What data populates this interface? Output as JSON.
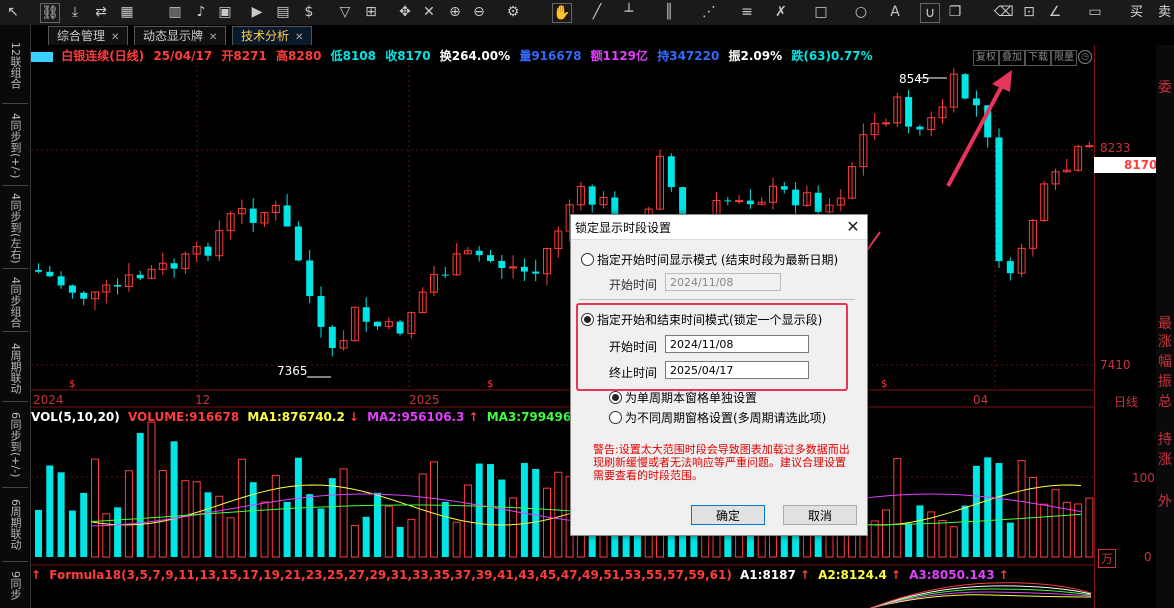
{
  "toolbar": {
    "buy_label": "买",
    "sell_label": "卖"
  },
  "tabs": [
    {
      "label": "综合管理"
    },
    {
      "label": "动态显示牌"
    },
    {
      "label": "技术分析"
    }
  ],
  "sidebar": {
    "items": [
      "12联组合",
      "4同步到(+/-)",
      "4同步到(左右)",
      "4同步组合",
      "4周期联动",
      "6同步到(+/-)",
      "6周期联动",
      "9同步"
    ]
  },
  "quote": {
    "name": "白银连续(日线)",
    "date": "25/04/17",
    "open": "开8271",
    "high": "高8280",
    "low": "低8108",
    "close": "收8170",
    "turnover": "换264.00%",
    "volume": "量916678",
    "amount": "额1129亿",
    "position": "持347220",
    "amplitude": "振2.09%",
    "change": "跌(63)0.77%"
  },
  "chart_tools": [
    "复权",
    "叠加",
    "下载",
    "限量"
  ],
  "chart_labels": {
    "price_high": "8545",
    "price_low": "7365",
    "axis_top": "8233",
    "axis_current": "8170",
    "axis_low": "7410",
    "axis_period": "日线",
    "vol_100": "100",
    "vol_0": "0",
    "vol_unit": "万",
    "date_2024": "2024",
    "date_12": "12",
    "date_2025": "2025",
    "date_04": "04"
  },
  "volume_bar": {
    "title": "VOL(5,10,20)",
    "volume": "VOLUME:916678",
    "ma1": "MA1:876740.2",
    "ma2": "MA2:956106.3",
    "ma3": "MA3:799496.6"
  },
  "formula_bar": {
    "title": "Formula18(3,5,7,9,11,13,15,17,19,21,23,25,27,29,31,33,35,37,39,41,43,45,47,49,51,53,55,57,59,61)",
    "a1": "A1:8187",
    "a2": "A2:8124.4",
    "a3": "A3:8050.143"
  },
  "right_panel": [
    "委",
    "最",
    "涨",
    "幅",
    "振",
    "总",
    "持",
    "涨",
    "外"
  ],
  "dialog": {
    "title": "锁定显示时段设置",
    "option1_label": "指定开始时间显示模式 (结束时段为最新日期)",
    "option1_start_label": "开始时间",
    "option1_start_value": "2024/11/08",
    "option2_label": "指定开始和结束时间模式(锁定一个显示段)",
    "option2_start_label": "开始时间",
    "option2_start_value": "2024/11/08",
    "option2_end_label": "终止时间",
    "option2_end_value": "2025/04/17",
    "scope1_label": "为单周期本窗格单独设置",
    "scope2_label": "为不同周期窗格设置(多周期请选此项)",
    "warning": "警告:设置太大范围时段会导致图表加载过多数据而出现刷新缓慢或者无法响应等严重问题。建议合理设置需要查看的时段范围。",
    "ok_label": "确定",
    "cancel_label": "取消"
  },
  "colors": {
    "up": "#ff3c3c",
    "down": "#00e5e5",
    "highlight": "#e8345a"
  }
}
